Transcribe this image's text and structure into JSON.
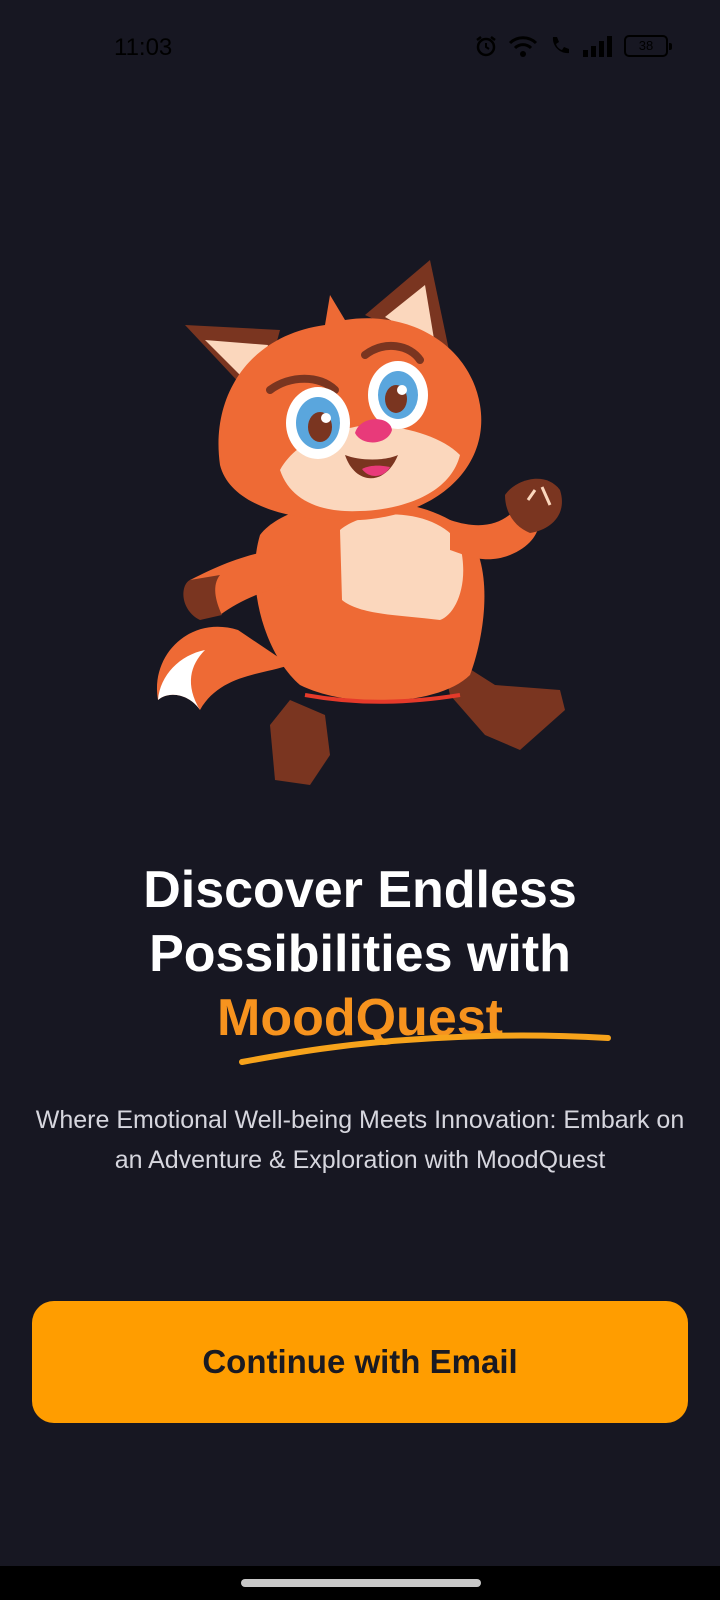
{
  "status_bar": {
    "time": "11:03",
    "battery": "38",
    "icons": [
      "alarm-icon",
      "wifi-icon",
      "call-icon",
      "signal-icon",
      "battery-icon"
    ]
  },
  "hero": {
    "image": "fox-mascot"
  },
  "headline": {
    "line1": "Discover Endless",
    "line2": "Possibilities with",
    "brand": "MoodQuest"
  },
  "subtitle": "Where Emotional Well-being Meets Innovation: Embark on an Adventure & Exploration with MoodQuest",
  "cta": {
    "label": "Continue with Email"
  },
  "colors": {
    "background": "#171722",
    "accent": "#f7931e",
    "button": "#ff9d00",
    "fox_orange": "#ee6a35"
  }
}
